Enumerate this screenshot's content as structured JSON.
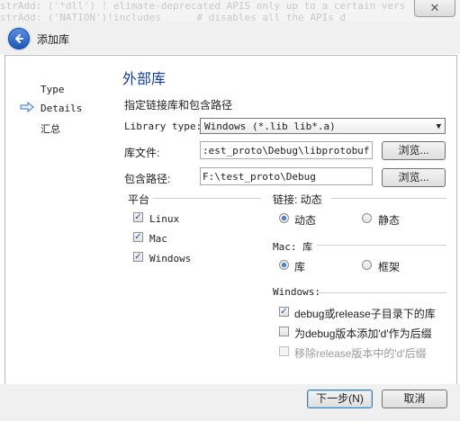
{
  "background_text": [
    "strAdd: ('*dll') ! elimate-deprecated APIS only up to a certain vers",
    "strAdd: ('NATION')!includes      # disables all the APIs d"
  ],
  "window": {
    "title": "添加库",
    "back_icon": "back-arrow-icon",
    "close_icon": "close-icon",
    "close_glyph": "✕"
  },
  "nav": {
    "items": [
      {
        "label": "Type",
        "active": false
      },
      {
        "label": "Details",
        "active": true
      },
      {
        "label": "汇总",
        "active": false
      }
    ]
  },
  "main": {
    "heading": "外部库",
    "subheading": "指定链接库和包含路径",
    "library_type_label": "Library type:",
    "library_type_value": "Windows (*.lib lib*.a)",
    "lib_file_label": "库文件:",
    "lib_file_value": ":est_proto\\Debug\\libprotobuf.lib",
    "include_path_label": "包含路径:",
    "include_path_value": "F:\\test_proto\\Debug",
    "browse_label": "浏览...",
    "platform": {
      "title": "平台",
      "options": [
        {
          "label": "Linux",
          "checked": true
        },
        {
          "label": "Mac",
          "checked": true
        },
        {
          "label": "Windows",
          "checked": true
        }
      ]
    },
    "link_group": {
      "title": "链接: 动态",
      "options": [
        {
          "label": "动态",
          "selected": true
        },
        {
          "label": "静态",
          "selected": false
        }
      ]
    },
    "mac_group": {
      "title": "Mac: 库",
      "options": [
        {
          "label": "库",
          "selected": true
        },
        {
          "label": "框架",
          "selected": false
        }
      ]
    },
    "windows_group": {
      "title": "Windows:",
      "options": [
        {
          "label": "debug或release子目录下的库",
          "checked": true,
          "enabled": true
        },
        {
          "label": "为debug版本添加'd'作为后缀",
          "checked": false,
          "enabled": true
        },
        {
          "label": "移除release版本中的'd'后缀",
          "checked": false,
          "enabled": false
        }
      ]
    }
  },
  "footer": {
    "next_label": "下一步(N)",
    "cancel_label": "取消"
  },
  "colors": {
    "heading": "#1a3e96",
    "accent": "#1d4fa8"
  }
}
